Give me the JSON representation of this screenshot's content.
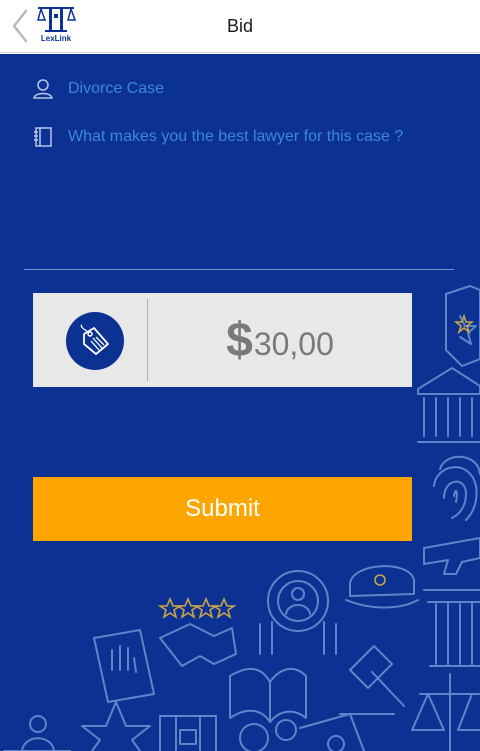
{
  "header": {
    "title": "Bid",
    "logo_text": "LexLink",
    "back_icon": "chevron-left-icon"
  },
  "form": {
    "case_name": "Divorce Case",
    "case_icon": "user-icon",
    "pitch_placeholder": "What makes you the best lawyer for this case ?",
    "pitch_icon": "notebook-icon"
  },
  "bid": {
    "currency_symbol": "$",
    "amount": "30,00",
    "tag_icon": "price-tag-icon"
  },
  "actions": {
    "submit_label": "Submit"
  },
  "colors": {
    "primary": "#0b3293",
    "accent": "#ffa500",
    "link_text": "#3d87d8",
    "price_box": "#e8e8e8",
    "decor_line": "#5b86c8",
    "decor_gold": "#c9a349"
  }
}
